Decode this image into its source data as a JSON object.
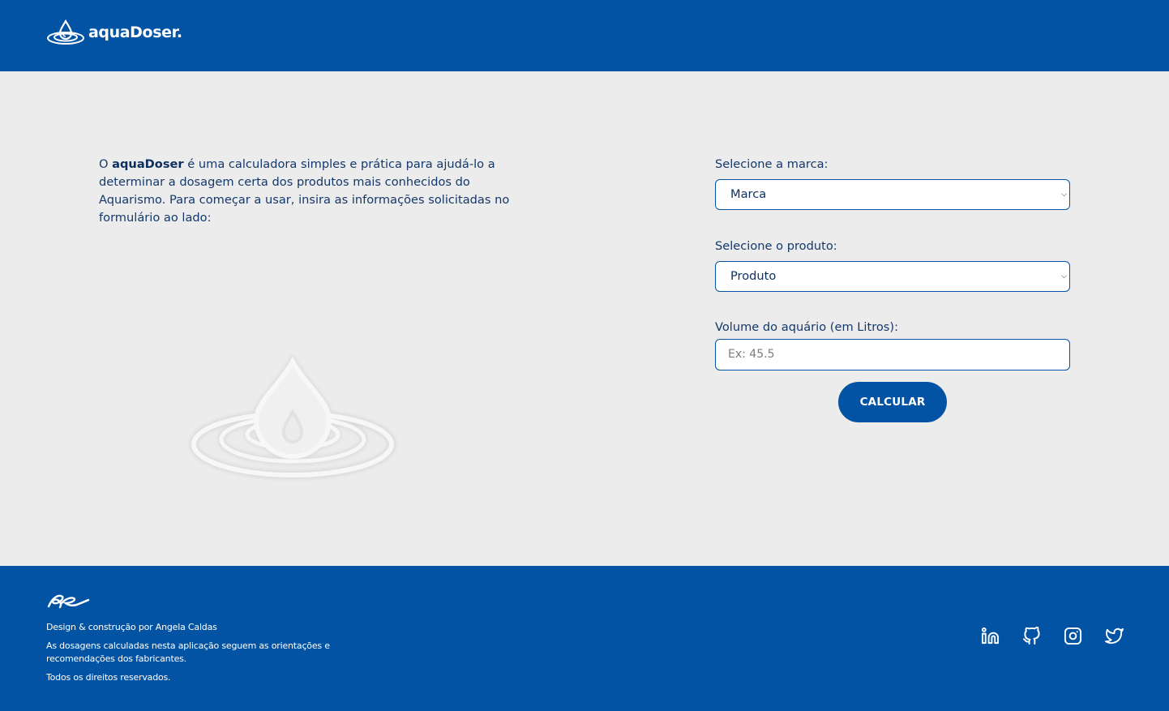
{
  "header": {
    "brand": "aquaDoser."
  },
  "intro": {
    "prefix": "O ",
    "brand": "aquaDoser",
    "rest": " é uma calculadora simples e prática para ajudá-lo a determinar a dosagem certa dos produtos mais conhecidos do Aquarismo. Para começar a usar, insira as informações solicitadas no formulário ao lado:"
  },
  "form": {
    "brand_label": "Selecione a marca:",
    "brand_value": "Marca",
    "product_label": "Selecione o produto:",
    "product_value": "Produto",
    "volume_label": "Volume do aquário (em Litros):",
    "volume_placeholder": "Ex: 45.5",
    "submit_label": "CALCULAR"
  },
  "footer": {
    "credit": "Design & construção por Angela Caldas",
    "disclaimer": "As dosagens calculadas nesta aplicação seguem as orientações e recomendações dos fabricantes.",
    "rights": "Todos os direitos reservados.",
    "socials": [
      "linkedin-icon",
      "github-icon",
      "instagram-icon",
      "twitter-icon"
    ]
  },
  "colors": {
    "primary": "#0253a3",
    "background": "#ececec",
    "text": "#14386b"
  }
}
